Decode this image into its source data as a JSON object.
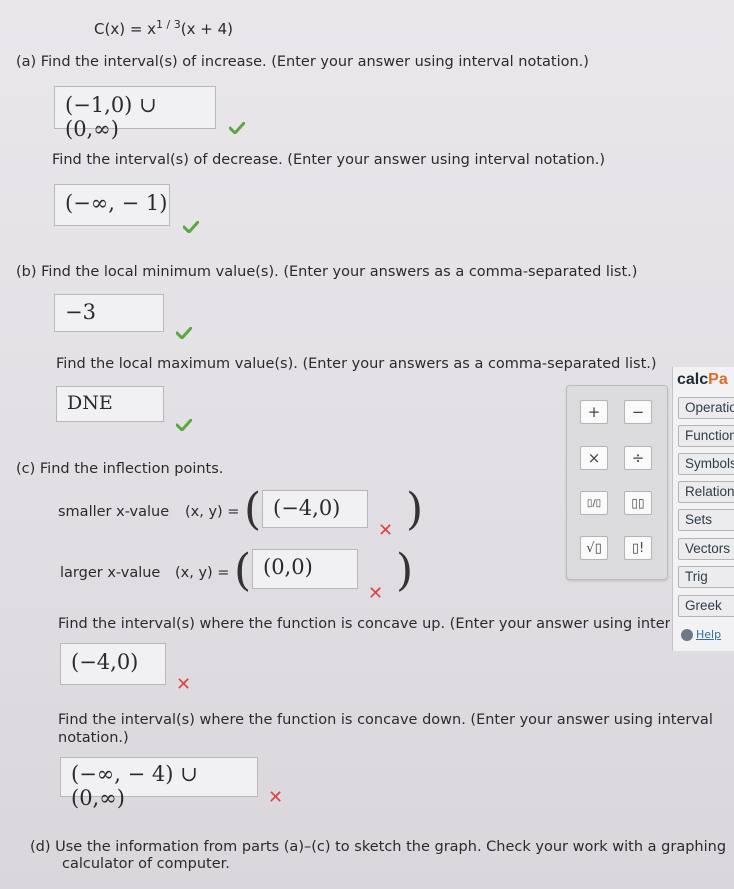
{
  "function": {
    "lhs": "C(x) = x",
    "exp": "1 / 3",
    "rhs": "(x + 4)"
  },
  "part_a": {
    "increase_prompt": "(a)  Find the interval(s) of increase. (Enter your answer using interval notation.)",
    "increase_answer": "(−1,0) ∪ (0,∞)",
    "decrease_prompt": "Find the interval(s) of decrease. (Enter your answer using interval notation.)",
    "decrease_answer": "(−∞, − 1)"
  },
  "part_b": {
    "min_prompt": "(b)  Find the local minimum value(s). (Enter your answers as a comma-separated list.)",
    "min_answer": "−3",
    "max_prompt": "Find the local maximum value(s). (Enter your answers as a comma-separated list.)",
    "max_answer": "DNE"
  },
  "part_c": {
    "inflection_prompt": "(c)  Find the inflection points.",
    "smaller_label": "smaller x-value",
    "larger_label": "larger x-value",
    "xy_label": "(x, y) =",
    "smaller_answer": "(−4,0)",
    "larger_answer": "(0,0)",
    "concave_up_prompt": "Find the interval(s) where the function is concave up. (Enter your answer using interv",
    "concave_up_answer": "(−4,0)",
    "concave_down_prompt": "Find the interval(s) where the function is concave down. (Enter your answer using interval",
    "concave_down_prompt_2": "notation.)",
    "concave_down_answer": "(−∞, − 4) ∪ (0,∞)"
  },
  "part_d": {
    "line1": "(d)  Use the information from parts (a)–(c) to sketch the graph. Check your work with a graphing",
    "line2": "calculator of computer."
  },
  "palette": {
    "plus": "+",
    "minus": "−",
    "times": "×",
    "divide": "÷",
    "fraction": "▯/▯",
    "power": "▯▯",
    "sqrt": "√▯",
    "factorial": "▯!"
  },
  "calcpad": {
    "title_calc": "calc",
    "title_pad": "Pa",
    "buttons": [
      "Operatio",
      "Function",
      "Symbols",
      "Relation",
      "Sets",
      "Vectors",
      "Trig",
      "Greek"
    ],
    "help": "Help"
  },
  "colors": {
    "check": "#5aa842",
    "cross": "#e04343",
    "calcpad_accent": "#e26a2c"
  }
}
